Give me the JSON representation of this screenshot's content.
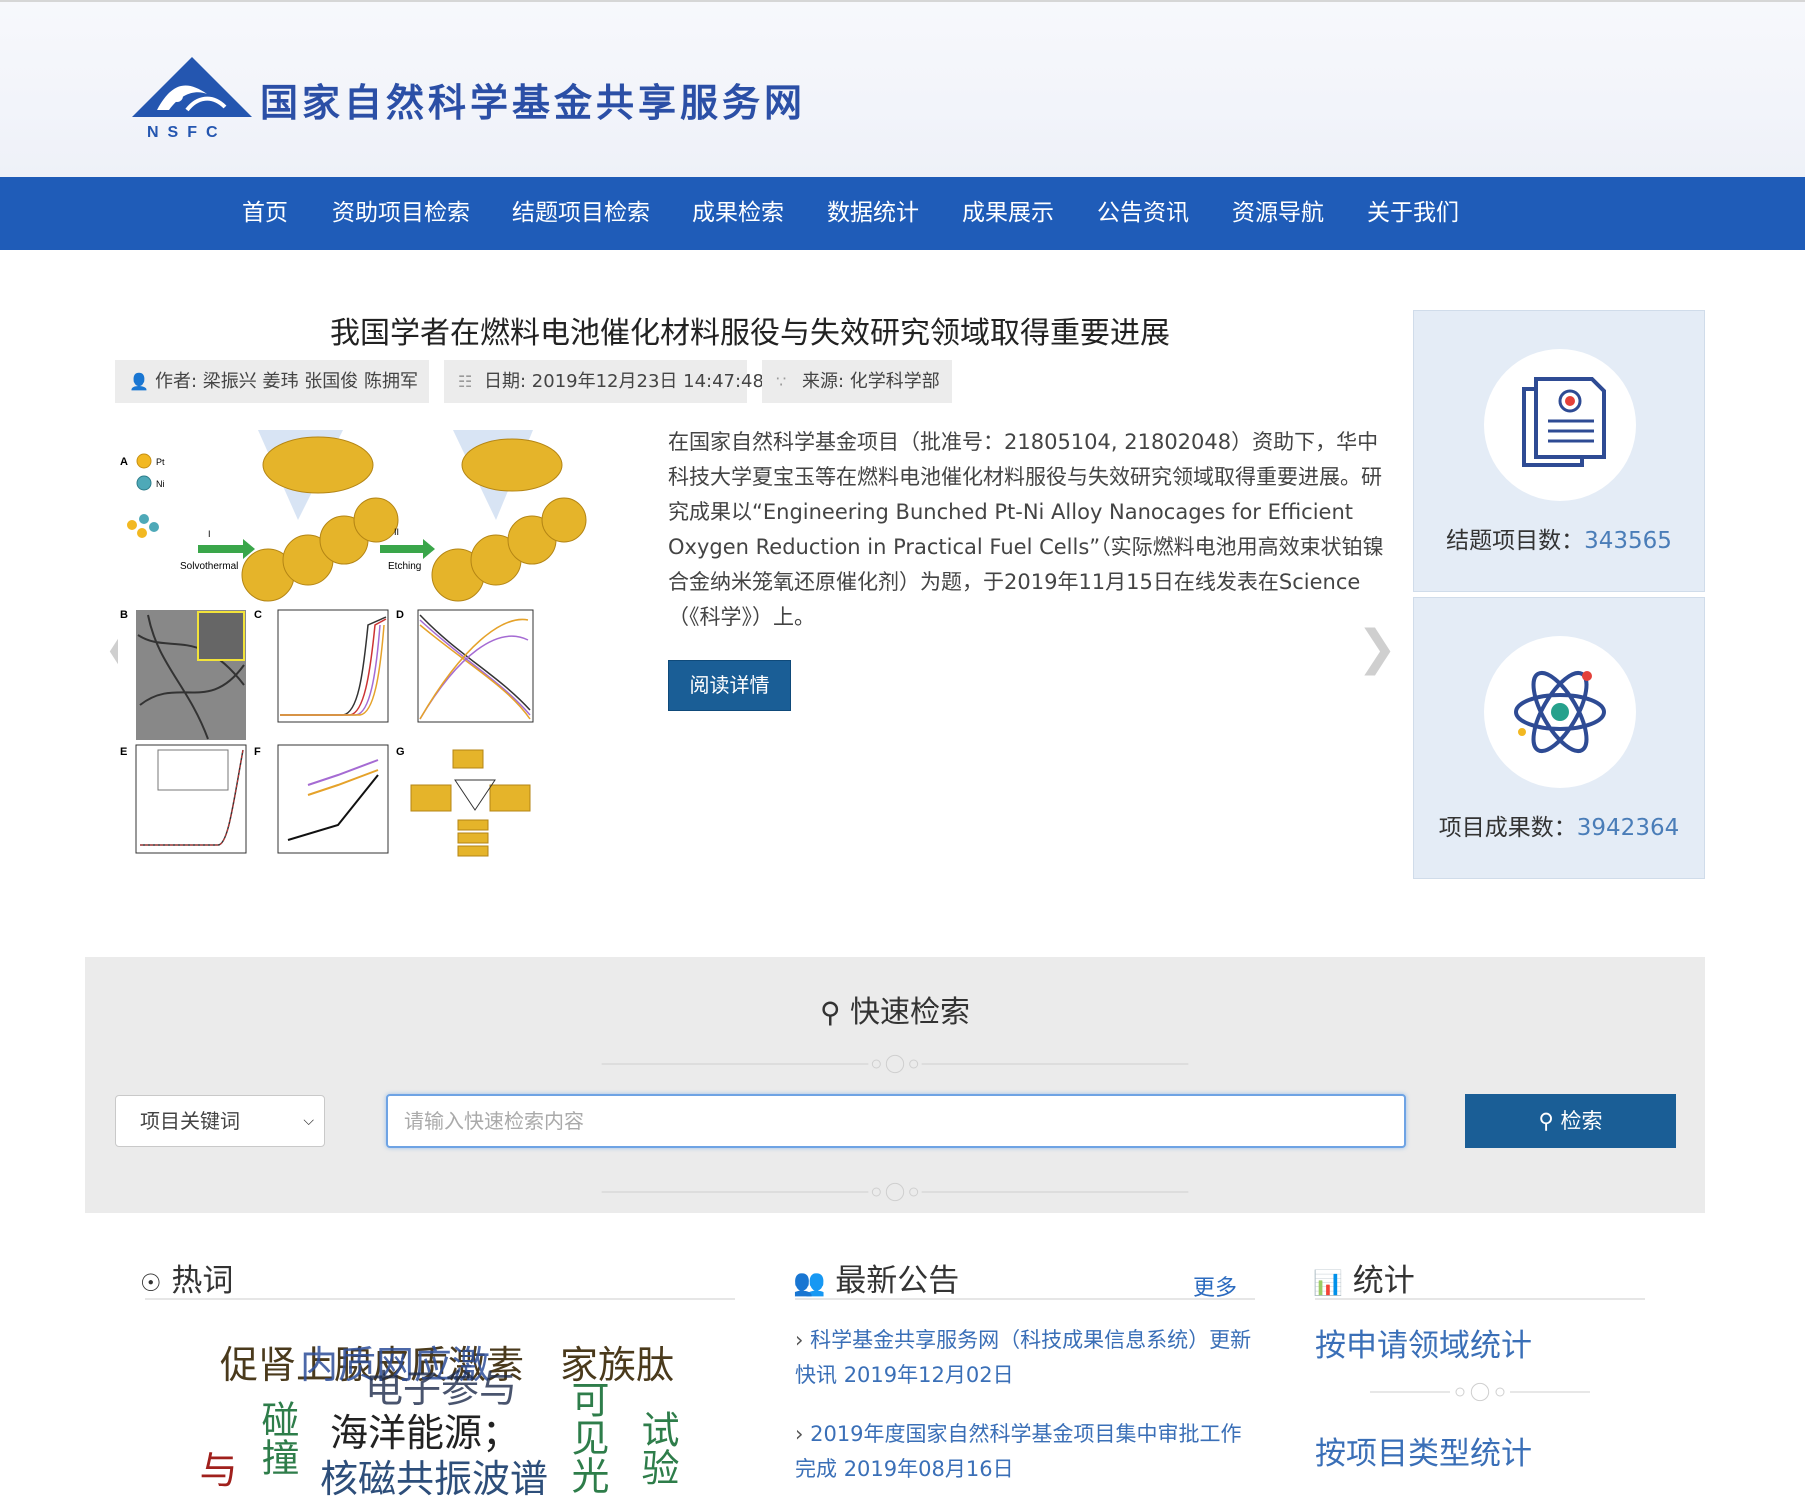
{
  "colors": {
    "brand_blue": "#1f5cb8",
    "button_blue": "#1a5e96",
    "link_blue": "#3a6fb7",
    "stat_bg": "#e4ecf6",
    "panel_bg": "#ebebeb"
  },
  "header": {
    "logo_text": "国家自然科学基金共享服务网",
    "logo_abbr": "NSFC"
  },
  "nav": [
    "首页",
    "资助项目检索",
    "结题项目检索",
    "成果检索",
    "数据统计",
    "成果展示",
    "公告资讯",
    "资源导航",
    "关于我们"
  ],
  "article": {
    "title": "我国学者在燃料电池催化材料服役与失效研究领域取得重要进展",
    "author": "作者: 梁振兴 姜玮 张国俊 陈拥军",
    "date": "日期: 2019年12月23日 14:47:48",
    "source": "来源: 化学科学部",
    "abstract": "在国家自然科学基金项目（批准号：21805104, 21802048）资助下，华中科技大学夏宝玉等在燃料电池催化材料服役与失效研究领域取得重要进展。研究成果以“Engineering Bunched Pt-Ni Alloy Nanocages for Efficient Oxygen Reduction in Practical Fuel Cells”（实际燃料电池用高效束状铂镍合金纳米笼氧还原催化剂）为题，于2019年11月15日在线发表在Science（《科学》）上。",
    "read_more": "阅读详情",
    "figure_labels": {
      "a": "A",
      "b": "B",
      "c": "C",
      "d": "D",
      "e": "E",
      "f": "F",
      "g": "G",
      "pt": "Pt",
      "ni": "Ni",
      "step1": "I",
      "step2": "II",
      "solvothermal": "Solvothermal",
      "etching": "Etching"
    }
  },
  "stats": [
    {
      "label": "结题项目数：",
      "value": "343565",
      "icon": "document-certificate-icon"
    },
    {
      "label": "项目成果数：",
      "value": "3942364",
      "icon": "atom-icon"
    }
  ],
  "search": {
    "title": "快速检索",
    "select_value": "项目关键词",
    "placeholder": "请输入快速检索内容",
    "button": "检索"
  },
  "hotwords": {
    "title": "热词",
    "words": [
      "促肾上腺皮质激素",
      "内质网应激",
      "家族肽",
      "电子参与",
      "海洋能源；",
      "核磁共振波谱",
      "碰撞",
      "与",
      "试验",
      "可见光"
    ]
  },
  "notices": {
    "title": "最新公告",
    "more": "更多",
    "items": [
      {
        "text": "科学基金共享服务网（科技成果信息系统）更新快讯",
        "date": "2019年12月02日"
      },
      {
        "text": "2019年度国家自然科学基金项目集中审批工作完成",
        "date": "2019年08月16日"
      }
    ]
  },
  "statistics": {
    "title": "统计",
    "links": [
      "按申请领域统计",
      "按项目类型统计"
    ]
  }
}
